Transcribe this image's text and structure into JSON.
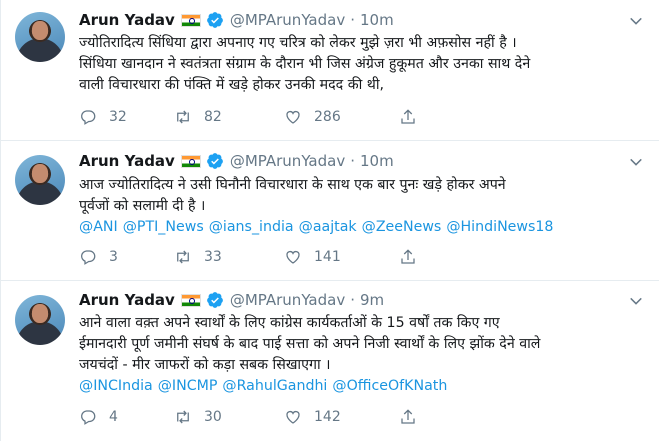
{
  "accent_color": "#1b95e0",
  "tweets": [
    {
      "name": "Arun Yadav",
      "handle": "@MPArunYadav",
      "separator": "·",
      "time": "10m",
      "lines": [
        "ज्योतिरादित्य सिंधिया द्वारा अपनाए गए चरित्र को लेकर मुझे ज़रा भी अफ़सोस नहीं है ।",
        "सिंधिया खानदान ने स्वतंत्रता संग्राम के दौरान भी जिस अंग्रेज हुकूमत और उनका साथ देने",
        "वाली विचारधारा की पंक्ति में खड़े होकर उनकी मदद की थी,"
      ],
      "mentions": [],
      "replies": "32",
      "retweets": "82",
      "likes": "286"
    },
    {
      "name": "Arun Yadav",
      "handle": "@MPArunYadav",
      "separator": "·",
      "time": "10m",
      "lines": [
        "आज ज्योतिरादित्य ने उसी घिनौनी विचारधारा के साथ एक बार पुनः खड़े होकर अपने",
        "पूर्वजों को सलामी दी है ।"
      ],
      "mentions": [
        "@ANI",
        "@PTI_News",
        "@ians_india",
        "@aajtak",
        "@ZeeNews",
        "@HindiNews18"
      ],
      "replies": "3",
      "retweets": "33",
      "likes": "141"
    },
    {
      "name": "Arun Yadav",
      "handle": "@MPArunYadav",
      "separator": "·",
      "time": "9m",
      "lines": [
        "आने वाला वक़्त अपने स्वार्थों के लिए कांग्रेस कार्यकर्ताओं के 15 वर्षों तक किए गए",
        "ईमानदारी पूर्ण जमीनी संघर्ष के बाद पाई सत्ता को अपने निजी स्वार्थों के लिए झोंक देने वाले",
        "जयचंदों - मीर जाफरों को  कड़ा सबक सिखाएगा ।"
      ],
      "mentions": [
        "@INCIndia",
        "@INCMP",
        "@RahulGandhi",
        "@OfficeOfKNath"
      ],
      "replies": "4",
      "retweets": "30",
      "likes": "142"
    }
  ]
}
